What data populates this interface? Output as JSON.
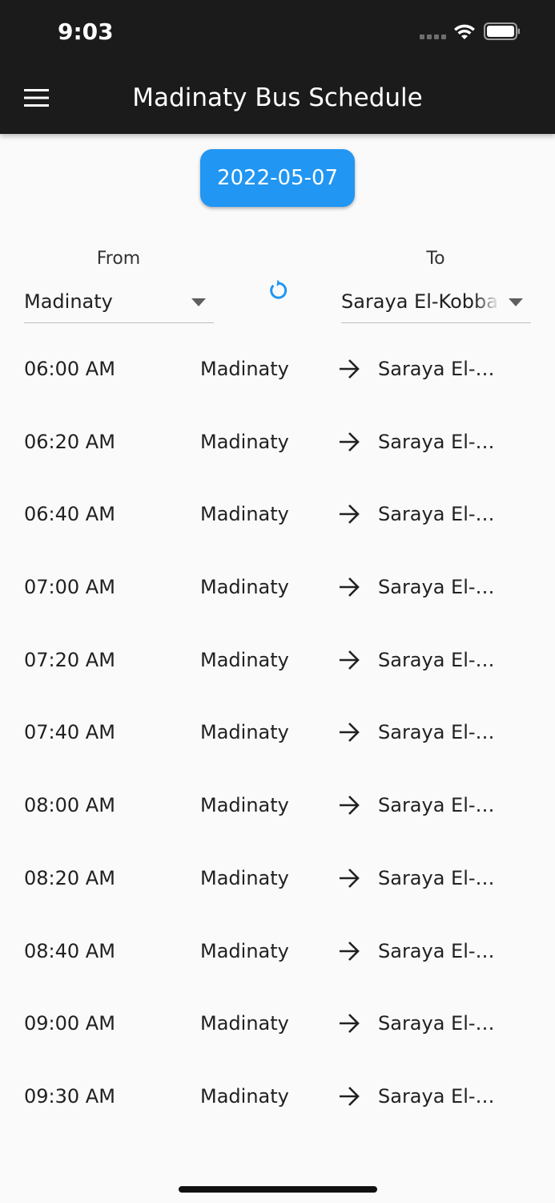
{
  "status_bar": {
    "time": "9:03"
  },
  "app_bar": {
    "title": "Madinaty Bus Schedule",
    "menu_icon": "menu-icon"
  },
  "date_button": {
    "label": "2022-05-07"
  },
  "route": {
    "from_label": "From",
    "to_label": "To",
    "from_value": "Madinaty",
    "to_value": "Saraya El-Kobba",
    "swap_icon": "swap-refresh-icon"
  },
  "trips": [
    {
      "time": "06:00 AM",
      "origin": "Madinaty",
      "destination": "Saraya El-…"
    },
    {
      "time": "06:20 AM",
      "origin": "Madinaty",
      "destination": "Saraya El-…"
    },
    {
      "time": "06:40 AM",
      "origin": "Madinaty",
      "destination": "Saraya El-…"
    },
    {
      "time": "07:00 AM",
      "origin": "Madinaty",
      "destination": "Saraya El-…"
    },
    {
      "time": "07:20 AM",
      "origin": "Madinaty",
      "destination": "Saraya El-…"
    },
    {
      "time": "07:40 AM",
      "origin": "Madinaty",
      "destination": "Saraya El-…"
    },
    {
      "time": "08:00 AM",
      "origin": "Madinaty",
      "destination": "Saraya El-…"
    },
    {
      "time": "08:20 AM",
      "origin": "Madinaty",
      "destination": "Saraya El-…"
    },
    {
      "time": "08:40 AM",
      "origin": "Madinaty",
      "destination": "Saraya El-…"
    },
    {
      "time": "09:00 AM",
      "origin": "Madinaty",
      "destination": "Saraya El-…"
    },
    {
      "time": "09:30 AM",
      "origin": "Madinaty",
      "destination": "Saraya El-…"
    }
  ],
  "colors": {
    "app_bar": "#1b1b1b",
    "accent": "#2196f3",
    "background": "#fafafa",
    "text": "#212121"
  }
}
